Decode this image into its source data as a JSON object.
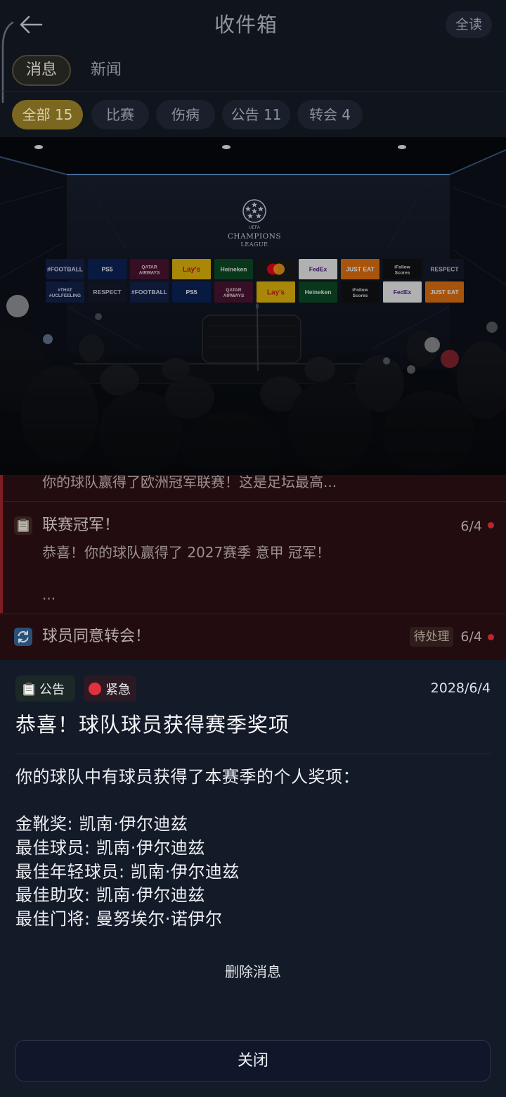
{
  "header": {
    "back_icon": "back-arrow-icon",
    "title": "收件箱",
    "mark_all_read": "全读"
  },
  "tabs": [
    {
      "label": "消息",
      "selected": true
    },
    {
      "label": "新闻",
      "selected": false
    }
  ],
  "filters": [
    {
      "label": "全部 15",
      "selected": true
    },
    {
      "label": "比赛",
      "selected": false
    },
    {
      "label": "伤病",
      "selected": false
    },
    {
      "label": "公告 11",
      "selected": false
    },
    {
      "label": "转会 4",
      "selected": false
    }
  ],
  "backdrop": {
    "uefa_text": "UEFA",
    "champions_text": "CHAMPIONS",
    "league_text": "LEAGUE",
    "sponsors_top": [
      {
        "label": "#FOOTBALL",
        "bg": "#13204a",
        "fg": "#d8dcf0"
      },
      {
        "label": "PS5",
        "bg": "#0d2358",
        "fg": "#ffffff"
      },
      {
        "label": "QATAR\nAIRWAYS",
        "bg": "#4a1430",
        "fg": "#e8d8e0"
      },
      {
        "label": "Lay's",
        "bg": "#e2b40c",
        "fg": "#c8181e"
      },
      {
        "label": "Heineken",
        "bg": "#0c4a26",
        "fg": "#e8f0e8"
      },
      {
        "label": "",
        "logo": "mastercard-logo",
        "bg": "#1a1a1a",
        "fg": "#ffffff"
      },
      {
        "label": "FedEx",
        "bg": "#ececec",
        "fg": "#4a1c86"
      },
      {
        "label": "JUST EAT",
        "bg": "#e07010",
        "fg": "#ffffff"
      },
      {
        "label": "iFollow\nScores",
        "bg": "#101214",
        "fg": "#e0e0e0"
      },
      {
        "label": "RESPECT",
        "bg": "#14182a",
        "fg": "#c8c8d0"
      }
    ],
    "sponsors_bottom": [
      {
        "label": "#THAT\n#UCLFEELING",
        "bg": "#13204a",
        "fg": "#d8dcf0"
      },
      {
        "label": "RESPECT",
        "bg": "#14182a",
        "fg": "#c8c8d0"
      },
      {
        "label": "#FOOTBALL",
        "bg": "#13204a",
        "fg": "#d8dcf0"
      },
      {
        "label": "PS5",
        "bg": "#0d2358",
        "fg": "#ffffff"
      },
      {
        "label": "QATAR\nAIRWAYS",
        "bg": "#4a1430",
        "fg": "#e8d8e0"
      },
      {
        "label": "Lay's",
        "bg": "#e2b40c",
        "fg": "#c8181e"
      },
      {
        "label": "Heineken",
        "bg": "#0c4a26",
        "fg": "#e8f0e8"
      },
      {
        "label": "iFollow\nScores",
        "bg": "#101214",
        "fg": "#e0e0e0"
      },
      {
        "label": "FedEx",
        "bg": "#ececec",
        "fg": "#4a1c86"
      },
      {
        "label": "JUST EAT",
        "bg": "#e07010",
        "fg": "#ffffff"
      }
    ]
  },
  "messages": [
    {
      "body": "你的球队赢得了欧洲冠军联赛！这是足坛最高...",
      "highlighted": true
    },
    {
      "icon": "clipboard-icon",
      "title": "联赛冠军！",
      "date": "6/4",
      "unread": true,
      "body": "恭喜！你的球队赢得了 2027赛季 意甲 冠军！",
      "more": "...",
      "highlighted": true
    },
    {
      "icon": "transfer-icon",
      "title": "球员同意转会！",
      "status": "待处理",
      "date": "6/4",
      "unread": true
    }
  ],
  "detail": {
    "tags": [
      {
        "icon": "clipboard-icon",
        "label": "公告"
      },
      {
        "icon": "red-dot-icon",
        "label": "紧急"
      }
    ],
    "date": "2028/6/4",
    "title": "恭喜！球队球员获得赛季奖项",
    "intro": "你的球队中有球员获得了本赛季的个人奖项：",
    "awards": [
      "金靴奖: 凯南·伊尔迪兹",
      "最佳球员: 凯南·伊尔迪兹",
      "最佳年轻球员: 凯南·伊尔迪兹",
      "最佳助攻: 凯南·伊尔迪兹",
      "最佳门将: 曼努埃尔·诺伊尔"
    ],
    "delete_label": "删除消息",
    "close_label": "关闭"
  },
  "colors": {
    "accent_gold": "#7b671f",
    "urgent_red": "#e3303e",
    "unread_dot": "#b8282e",
    "sheet_bg": "#131a28",
    "list_bg": "#230c0f"
  }
}
